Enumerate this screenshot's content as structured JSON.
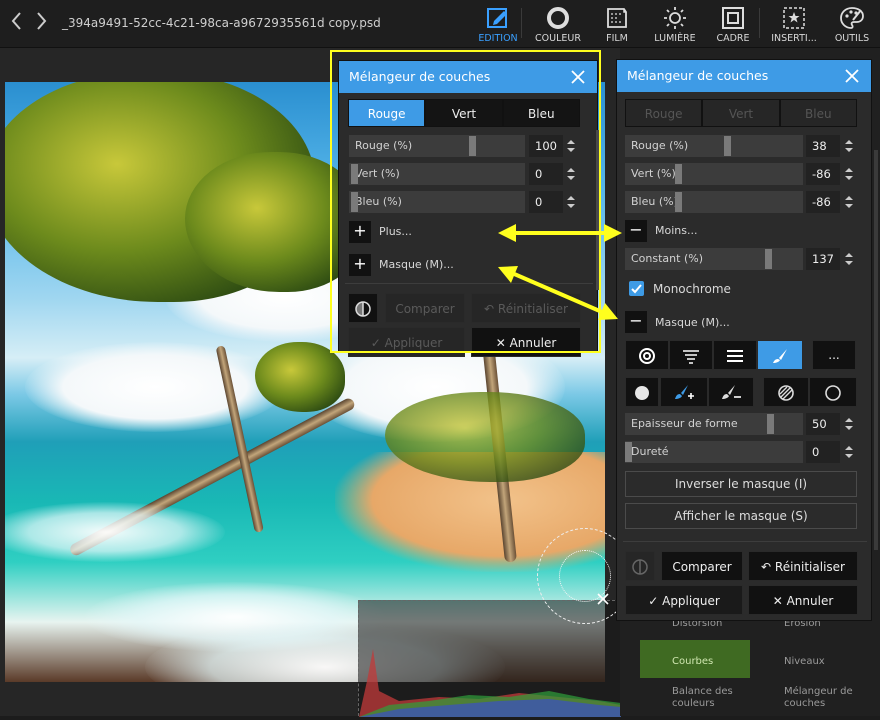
{
  "app": {
    "doc_title": "_394a9491-52cc-4c21-98ca-a9672935561d copy.psd",
    "back_icon": "chevron-left-icon",
    "forward_icon": "chevron-right-icon"
  },
  "toolbar": {
    "tools": [
      {
        "label": "EDITION",
        "icon": "edit-icon",
        "active": true
      },
      {
        "label": "COULEUR",
        "icon": "circle-icon"
      },
      {
        "label": "FILM",
        "icon": "film-icon"
      },
      {
        "label": "LUMIÈRE",
        "icon": "sun-icon"
      },
      {
        "label": "CADRE",
        "icon": "frame-icon"
      },
      {
        "label": "INSERTI...",
        "icon": "insert-icon"
      },
      {
        "label": "OUTILS",
        "icon": "palette-icon"
      }
    ],
    "accent": "#3aa0ff"
  },
  "sidebar_behind": {
    "items": [
      "Distorsion",
      "Érosion",
      "Courbes",
      "Niveaux",
      "Balance des couleurs",
      "Mélangeur de couches"
    ]
  },
  "panel_compact": {
    "title": "Mélangeur de couches",
    "channels": [
      "Rouge",
      "Vert",
      "Bleu"
    ],
    "active_channel": "Rouge",
    "sliders": [
      {
        "label": "Rouge (%)",
        "value": "100",
        "fraction": 0.71
      },
      {
        "label": "Vert (%)",
        "value": "0",
        "fraction": 0.01
      },
      {
        "label": "Bleu (%)",
        "value": "0",
        "fraction": 0.01
      }
    ],
    "more_label": "Plus...",
    "mask_label": "Masque (M)...",
    "compare_label": "Comparer",
    "reset_label": "Réinitialiser",
    "apply_label": "Appliquer",
    "cancel_label": "Annuler"
  },
  "panel_expanded": {
    "title": "Mélangeur de couches",
    "channels": [
      "Rouge",
      "Vert",
      "Bleu"
    ],
    "sliders": [
      {
        "label": "Rouge (%)",
        "value": "38",
        "fraction": 0.58
      },
      {
        "label": "Vert (%)",
        "value": "-86",
        "fraction": 0.29
      },
      {
        "label": "Bleu (%)",
        "value": "-86",
        "fraction": 0.29
      }
    ],
    "less_label": "Moins...",
    "constant": {
      "label": "Constant (%)",
      "value": "137",
      "fraction": 0.82
    },
    "monochrome_label": "Monochrome",
    "monochrome_checked": true,
    "mask_label": "Masque (M)...",
    "more_tools_label": "...",
    "shape_thickness": {
      "label": "Epaisseur de forme",
      "value": "50",
      "fraction": 0.83
    },
    "hardness": {
      "label": "Dureté",
      "value": "0",
      "fraction": 0.0
    },
    "invert_mask_label": "Inverser le masque (I)",
    "show_mask_label": "Afficher le masque (S)",
    "compare_label": "Comparer",
    "reset_label": "Réinitialiser",
    "apply_label": "Appliquer",
    "cancel_label": "Annuler"
  },
  "annotation": {
    "frame_color": "#ffff1e",
    "arrow_color": "#ffff1e"
  }
}
